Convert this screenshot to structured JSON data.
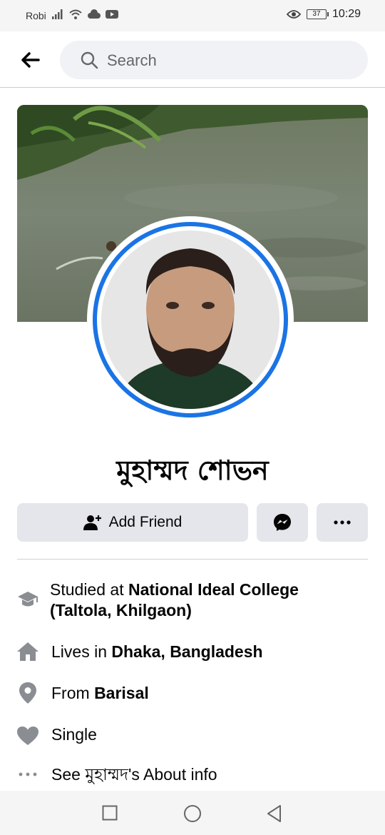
{
  "status_bar": {
    "carrier": "Robi",
    "battery": "37",
    "time": "10:29"
  },
  "search": {
    "placeholder": "Search"
  },
  "profile": {
    "name": "মুহাম্মদ শোভন"
  },
  "actions": {
    "add_friend_label": "Add Friend"
  },
  "intro": {
    "studied_prefix": "Studied at ",
    "studied_place": "National Ideal College (Taltola, Khilgaon)",
    "lives_prefix": "Lives in ",
    "lives_place": "Dhaka, Bangladesh",
    "from_prefix": "From ",
    "from_place": "Barisal",
    "relationship": "Single",
    "about_link": "See মুহাম্মদ's About info"
  },
  "icons": {
    "back": "arrow-left-icon",
    "search": "search-icon",
    "add_friend": "add-friend-icon",
    "messenger": "messenger-icon",
    "more": "more-icon",
    "education": "graduation-cap-icon",
    "home": "home-icon",
    "location": "location-pin-icon",
    "relationship": "heart-icon",
    "about": "ellipsis-icon"
  },
  "colors": {
    "accent": "#1b74e4",
    "button_bg": "#e4e6eb",
    "icon_gray": "#8a8d91"
  }
}
